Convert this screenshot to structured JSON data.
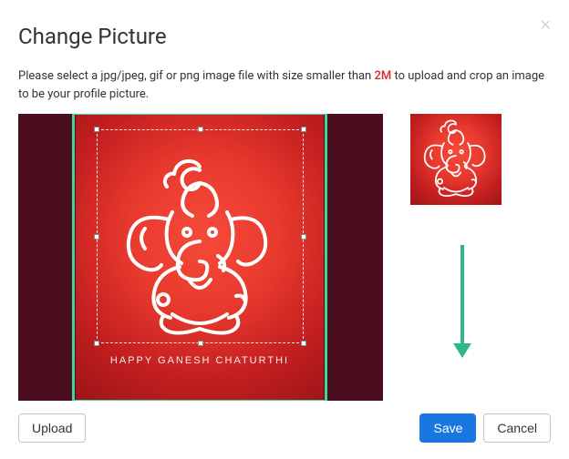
{
  "modal": {
    "title": "Change Picture",
    "instructions_pre": "Please select a jpg/jpeg, gif or png image file with size smaller than ",
    "size_limit": "2M",
    "instructions_post": " to upload and crop an image to be your profile picture.",
    "image_caption": "happy ganesh chaturthi"
  },
  "buttons": {
    "upload": "Upload",
    "save": "Save",
    "cancel": "Cancel"
  },
  "colors": {
    "accent": "#1a77e2",
    "highlight": "#3fd69a",
    "danger": "#d9252a"
  }
}
